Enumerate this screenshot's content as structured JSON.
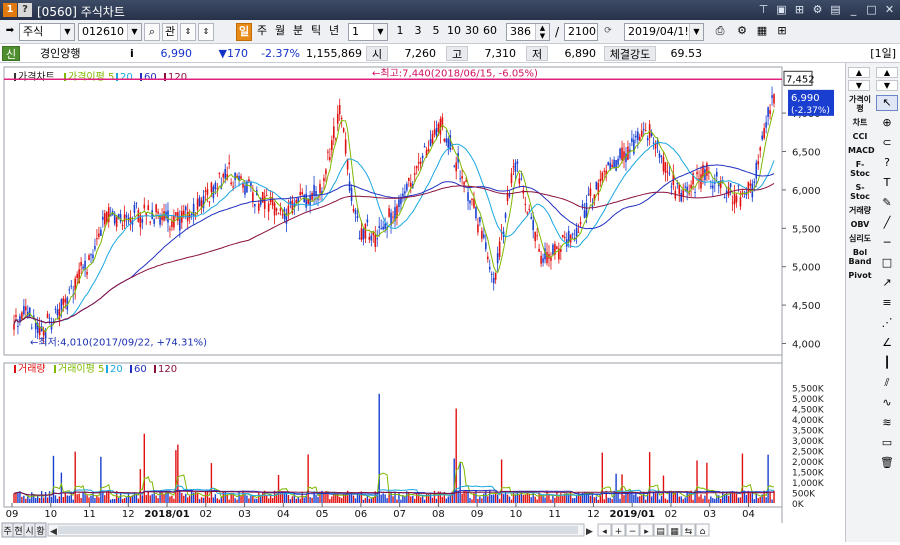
{
  "window": {
    "screen_number": "1",
    "help": "?",
    "title": "[0560] 주식차트"
  },
  "toolbar": {
    "market": "주식",
    "code": "012610",
    "search_icon": "⌕",
    "gwan": "관",
    "periods": [
      "일",
      "주",
      "월",
      "분",
      "틱",
      "년"
    ],
    "selected_period": "일",
    "interval": "1",
    "interval_options": [
      "1",
      "3",
      "5",
      "10",
      "30",
      "60"
    ],
    "count": "386",
    "total": "2100",
    "divider": "/",
    "date": "2019/04/1!"
  },
  "infobar": {
    "badge": "신",
    "name": "경인양행",
    "info_icon": "i",
    "price": "6,990",
    "change": "▼170",
    "change_pct": "-2.37%",
    "volume": "1,155,869",
    "open_label": "시",
    "open": "7,260",
    "high_label": "고",
    "high": "7,310",
    "low_label": "저",
    "low": "6,890",
    "strength_label": "체결강도",
    "strength": "69.53",
    "period_tag": "[1일]"
  },
  "price_panel": {
    "legend": [
      "가격차트",
      "가격이평 5",
      "20",
      "60",
      "120"
    ],
    "high_annotation": "←최고:7,440(2018/06/15, -6.05%)",
    "low_annotation": "←최저:4,010(2017/09/22, +74.31%)",
    "price_box": "6,990",
    "price_box_pct": "(-2.37%)",
    "top_box": "7,452",
    "y_labels": [
      "7,000",
      "6,500",
      "6,000",
      "5,500",
      "5,000",
      "4,500",
      "4,000"
    ]
  },
  "volume_panel": {
    "legend": [
      "거래량",
      "거래이평 5",
      "20",
      "60",
      "120"
    ],
    "y_labels": [
      "5,500K",
      "5,000K",
      "4,500K",
      "4,000K",
      "3,500K",
      "3,000K",
      "2,500K",
      "2,000K",
      "1,500K",
      "1,000K",
      "500K",
      "0K"
    ]
  },
  "x_axis": {
    "labels": [
      "09",
      "10",
      "11",
      "12",
      "2018/01",
      "02",
      "03",
      "04",
      "05",
      "06",
      "07",
      "08",
      "09",
      "10",
      "11",
      "12",
      "2019/01",
      "02",
      "03",
      "04"
    ]
  },
  "footer": {
    "tabs": [
      "주",
      "현",
      "시",
      "황"
    ]
  },
  "sidebar": {
    "indicators": [
      "가격이평",
      "차트",
      "CCI",
      "MACD",
      "F-Stoc",
      "S-Stoc",
      "거래량",
      "OBV",
      "심리도",
      "Bol Band",
      "Pivot"
    ]
  },
  "colors": {
    "up": "#e01010",
    "down": "#1a3fd0",
    "ma5": "#7fb800",
    "ma20": "#1aa8e0",
    "ma60": "#2030c0",
    "ma120": "#8a1040",
    "high_line": "#e0207c"
  }
}
